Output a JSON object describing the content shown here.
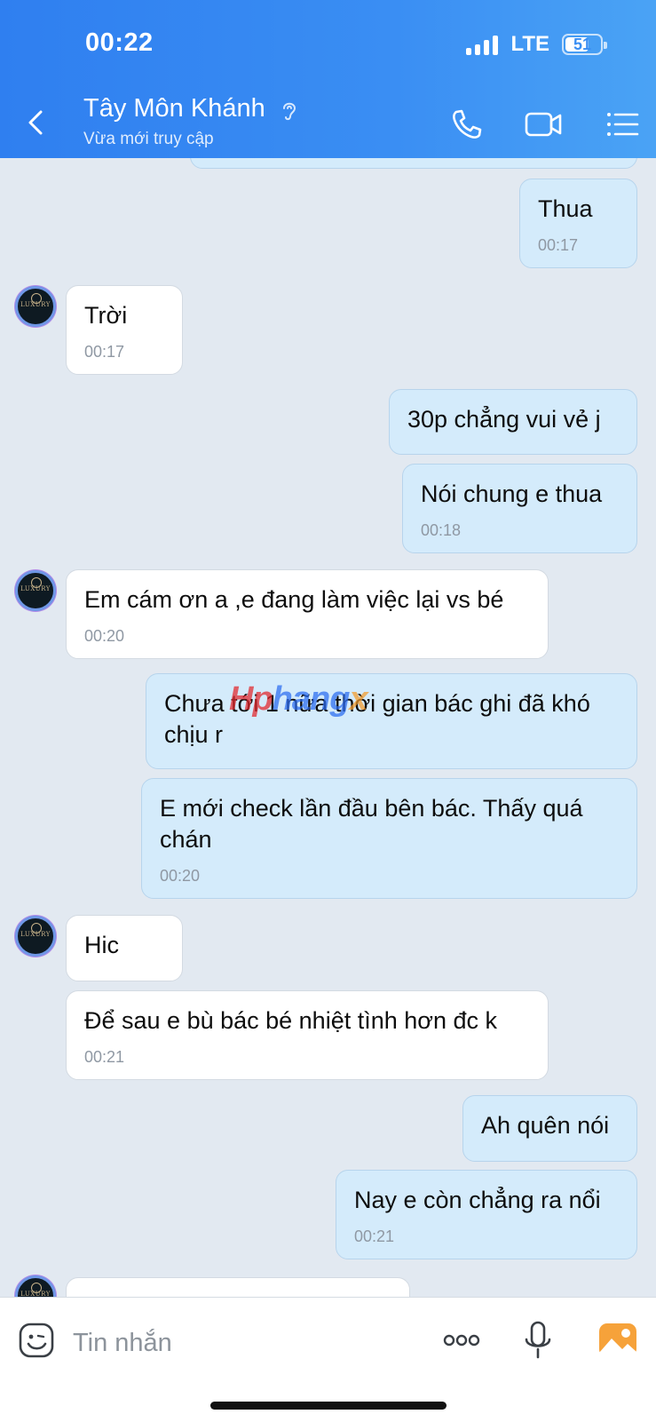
{
  "status_bar": {
    "time": "00:22",
    "network": "LTE",
    "battery": "51"
  },
  "header": {
    "contact_name": "Tây Môn Khánh",
    "contact_status": "Vừa mới truy cập",
    "icons": [
      "back-icon",
      "ear-icon",
      "phone-icon",
      "video-call-icon",
      "menu-list-icon"
    ]
  },
  "messages": [
    {
      "dir": "out",
      "text": "Thua",
      "time": "00:17"
    },
    {
      "dir": "in",
      "text": "Trời",
      "time": "00:17"
    },
    {
      "dir": "out",
      "text": "30p chẳng vui vẻ j",
      "time": ""
    },
    {
      "dir": "out",
      "text": "Nói chung e thua",
      "time": "00:18"
    },
    {
      "dir": "in",
      "text": "Em cám ơn a ,e đang làm việc lại vs bé",
      "time": "00:20"
    },
    {
      "dir": "out",
      "text": "Chưa tới 1 nữa thời gian bác ghi đã khó chịu r",
      "time": ""
    },
    {
      "dir": "out",
      "text": "E mới check lần đầu bên bác. Thấy quá chán",
      "time": "00:20"
    },
    {
      "dir": "in",
      "text": "Hic",
      "time": ""
    },
    {
      "dir": "in",
      "text": "Để sau e bù bác bé nhiệt tình hơn đc k",
      "time": "00:21"
    },
    {
      "dir": "out",
      "text": "Ah quên nói",
      "time": ""
    },
    {
      "dir": "out",
      "text": "Nay e còn chẳng ra nổi",
      "time": "00:21"
    }
  ],
  "avatar_text": "LUXURY",
  "watermark": {
    "part1": "Hp",
    "part2": "hang",
    "part3": "x"
  },
  "composer": {
    "placeholder": "Tin nhắn",
    "icons": [
      "emoji-icon",
      "more-icon",
      "microphone-icon",
      "image-icon"
    ]
  },
  "colors": {
    "header": "#3a8ef3",
    "outgoing_bubble": "#d4ebfb",
    "incoming_bubble": "#ffffff",
    "background": "#e2e9f1"
  }
}
